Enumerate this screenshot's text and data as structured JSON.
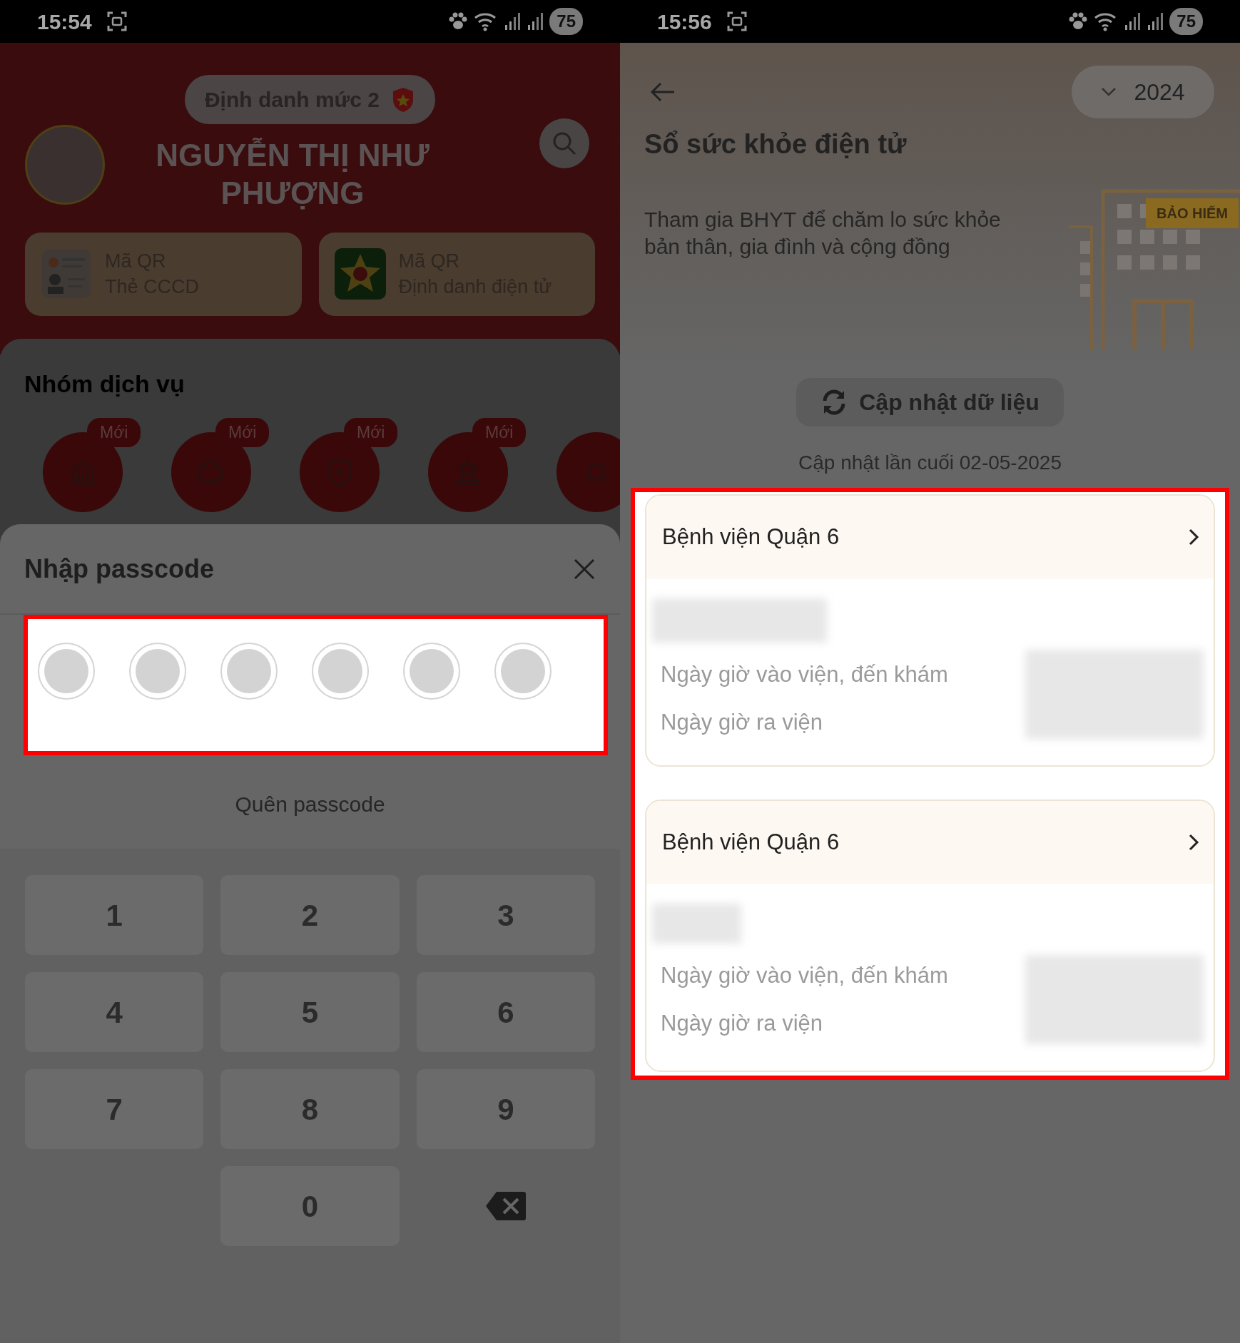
{
  "left_screen": {
    "status_bar": {
      "time": "15:54",
      "battery": "75"
    },
    "profile": {
      "level_badge": "Định danh mức 2",
      "name": "NGUYỄN THỊ NHƯ PHƯỢNG"
    },
    "qr_cards": [
      {
        "line1": "Mã QR",
        "line2": "Thẻ CCCD"
      },
      {
        "line1": "Mã QR",
        "line2": "Định danh điện tử"
      }
    ],
    "services": {
      "title": "Nhóm dịch vụ",
      "items": [
        {
          "is_new": true,
          "badge": "Mới"
        },
        {
          "is_new": true,
          "badge": "Mới"
        },
        {
          "is_new": true,
          "badge": "Mới"
        },
        {
          "is_new": true,
          "badge": "Mới"
        },
        {
          "is_new": false
        }
      ]
    },
    "passcode_sheet": {
      "title": "Nhập passcode",
      "highlighted": true,
      "digits": [
        {
          "filled": false
        },
        {
          "filled": false
        },
        {
          "filled": false
        },
        {
          "filled": false
        },
        {
          "filled": false
        },
        {
          "filled": false
        }
      ],
      "forgot_link": "Quên passcode",
      "keys": [
        {
          "kind": "digit",
          "label": "1"
        },
        {
          "kind": "digit",
          "label": "2"
        },
        {
          "kind": "digit",
          "label": "3"
        },
        {
          "kind": "digit",
          "label": "4"
        },
        {
          "kind": "digit",
          "label": "5"
        },
        {
          "kind": "digit",
          "label": "6"
        },
        {
          "kind": "digit",
          "label": "7"
        },
        {
          "kind": "digit",
          "label": "8"
        },
        {
          "kind": "digit",
          "label": "9"
        },
        {
          "kind": "digit",
          "label": "0"
        },
        {
          "kind": "backspace"
        }
      ]
    }
  },
  "right_screen": {
    "status_bar": {
      "time": "15:56",
      "battery": "75"
    },
    "year_select": "2024",
    "title": "Sổ sức khỏe điện tử",
    "description": "Tham gia BHYT để chăm lo sức khỏe bản thân, gia đình và cộng đồng",
    "illustration_sign": "BẢO HIỂM",
    "refresh_button": "Cập nhật dữ liệu",
    "last_updated": "Cập nhật lần cuối 02-05-2025",
    "records_highlighted": true,
    "records": [
      {
        "hospital": "Bệnh viện Quận 6",
        "admission_label": "Ngày giờ vào viện, đến khám",
        "discharge_label": "Ngày giờ ra viện"
      },
      {
        "hospital": "Bệnh viện Quận 6",
        "admission_label": "Ngày giờ vào viện, đến khám",
        "discharge_label": "Ngày giờ ra viện"
      }
    ]
  }
}
